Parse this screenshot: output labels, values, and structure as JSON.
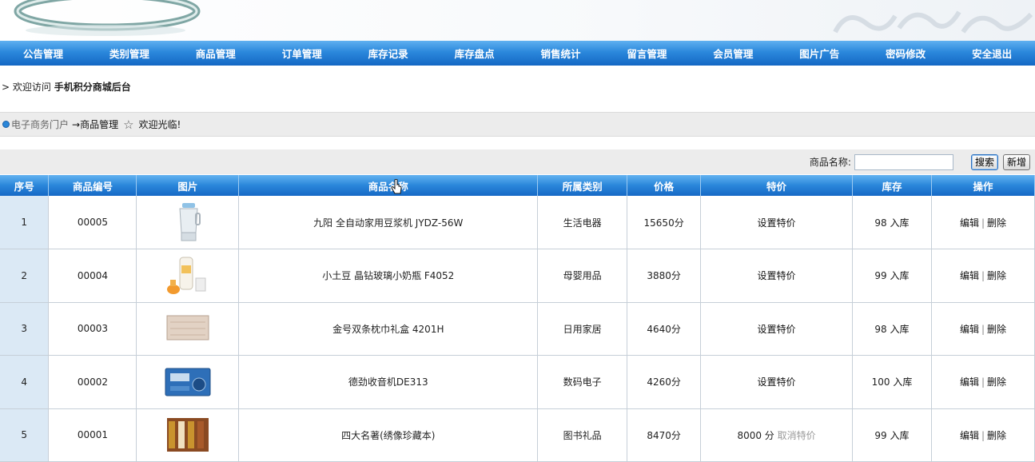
{
  "nav": [
    "公告管理",
    "类别管理",
    "商品管理",
    "订单管理",
    "库存记录",
    "库存盘点",
    "销售统计",
    "留言管理",
    "会员管理",
    "图片广告",
    "密码修改",
    "安全退出"
  ],
  "welcome": {
    "prefix": "> 欢迎访问",
    "site": "手机积分商城后台"
  },
  "breadcrumb": {
    "portal": "电子商务门户",
    "current": "→商品管理",
    "greeting": "欢迎光临!"
  },
  "search": {
    "label": "商品名称:",
    "value": "",
    "search_button": "搜索",
    "add_button": "新增"
  },
  "table": {
    "headers": [
      "序号",
      "商品编号",
      "图片",
      "商品名称",
      "所属类别",
      "价格",
      "特价",
      "库存",
      "操作"
    ],
    "rows": [
      {
        "no": "1",
        "code": "00005",
        "image": "soymilk-maker",
        "name": "九阳 全自动家用豆浆机 JYDZ-56W",
        "category": "生活电器",
        "price": "15650分",
        "special": "设置特价",
        "special_cancel": "",
        "stock": "98",
        "stock_action": "入库",
        "edit": "编辑",
        "delete": "删除"
      },
      {
        "no": "2",
        "code": "00004",
        "image": "baby-bottle",
        "name": "小土豆 晶钻玻璃小奶瓶 F4052",
        "category": "母婴用品",
        "price": "3880分",
        "special": "设置特价",
        "special_cancel": "",
        "stock": "99",
        "stock_action": "入库",
        "edit": "编辑",
        "delete": "删除"
      },
      {
        "no": "3",
        "code": "00003",
        "image": "towel-box",
        "name": "金号双条枕巾礼盒 4201H",
        "category": "日用家居",
        "price": "4640分",
        "special": "设置特价",
        "special_cancel": "",
        "stock": "98",
        "stock_action": "入库",
        "edit": "编辑",
        "delete": "删除"
      },
      {
        "no": "4",
        "code": "00002",
        "image": "radio",
        "name": "德劲收音机DE313",
        "category": "数码电子",
        "price": "4260分",
        "special": "设置特价",
        "special_cancel": "",
        "stock": "100",
        "stock_action": "入库",
        "edit": "编辑",
        "delete": "删除"
      },
      {
        "no": "5",
        "code": "00001",
        "image": "books",
        "name": "四大名著(绣像珍藏本)",
        "category": "图书礼品",
        "price": "8470分",
        "special": "8000 分",
        "special_cancel": "取消特价",
        "stock": "99",
        "stock_action": "入库",
        "edit": "编辑",
        "delete": "删除"
      }
    ]
  },
  "colors": {
    "nav": "#2b88dc",
    "header_row": "#2a86da",
    "index_cell": "#dbe9f5",
    "bar_gray": "#ececec"
  }
}
